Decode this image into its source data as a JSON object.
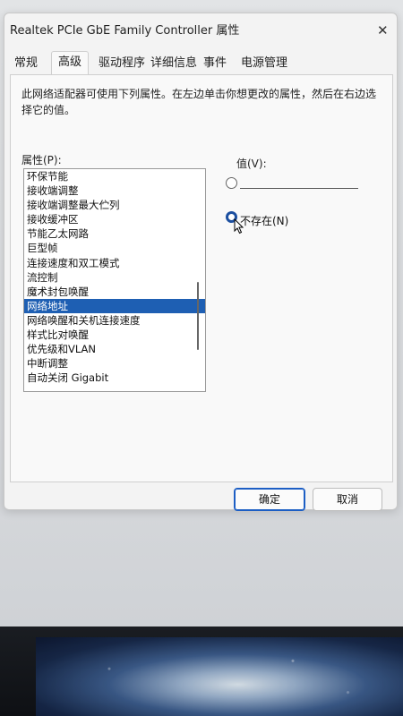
{
  "window": {
    "title": "Realtek PCIe GbE Family Controller 属性",
    "close_icon": "close-icon"
  },
  "tabs": [
    {
      "label": "常规"
    },
    {
      "label": "高级",
      "active": true
    },
    {
      "label": "驱动程序"
    },
    {
      "label": "详细信息"
    },
    {
      "label": "事件"
    },
    {
      "label": "电源管理"
    }
  ],
  "advanced": {
    "description": "此网络适配器可使用下列属性。在左边单击你想更改的属性，然后在右边选择它的值。",
    "property_label": "属性(P):",
    "properties": [
      "环保节能",
      "接收端调整",
      "接收端调整最大伫列",
      "接收缓冲区",
      "节能乙太网路",
      "巨型帧",
      "连接速度和双工模式",
      "流控制",
      "魔术封包唤醒",
      "网络地址",
      "网络唤醒和关机连接速度",
      "样式比对唤醒",
      "优先级和VLAN",
      "中断调整",
      "自动关闭 Gigabit"
    ],
    "selected_property": "网络地址",
    "value_label": "值(V):",
    "value_input": "",
    "not_present_label": "不存在(N)",
    "not_present_selected": true
  },
  "buttons": {
    "ok": "确定",
    "cancel": "取消"
  },
  "colors": {
    "selection": "#1e5fb3",
    "primary_border": "#1c5ec4"
  }
}
